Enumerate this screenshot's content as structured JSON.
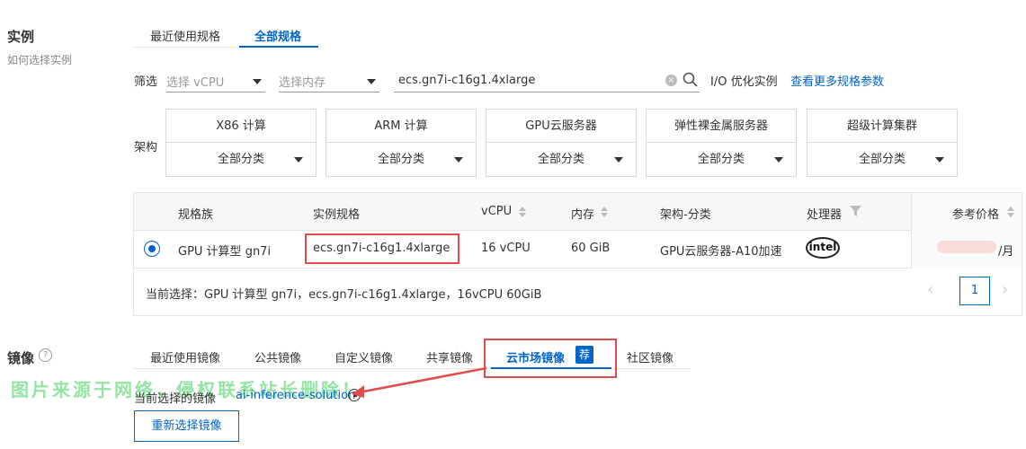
{
  "instance": {
    "section_label": "实例",
    "help_text": "如何选择实例",
    "tabs": [
      {
        "label": "最近使用规格",
        "active": false
      },
      {
        "label": "全部规格",
        "active": true
      }
    ],
    "filter": {
      "label": "筛选",
      "vcpu_placeholder": "选择 vCPU",
      "memory_placeholder": "选择内存",
      "search_value": "ecs.gn7i-c16g1.4xlarge",
      "io_optimized": "I/O 优化实例",
      "more_params_link": "查看更多规格参数"
    },
    "arch": {
      "label": "架构",
      "options": [
        {
          "name": "X86 计算",
          "value": "全部分类"
        },
        {
          "name": "ARM 计算",
          "value": "全部分类"
        },
        {
          "name": "GPU云服务器",
          "value": "全部分类"
        },
        {
          "name": "弹性裸金属服务器",
          "value": "全部分类"
        },
        {
          "name": "超级计算集群",
          "value": "全部分类"
        }
      ]
    },
    "table": {
      "headers": {
        "family": "规格族",
        "spec": "实例规格",
        "vcpu": "vCPU",
        "memory": "内存",
        "arch": "架构-分类",
        "processor": "处理器",
        "price": "参考价格"
      },
      "row": {
        "family": "GPU 计算型 gn7i",
        "spec": "ecs.gn7i-c16g1.4xlarge",
        "vcpu": "16 vCPU",
        "memory": "60 GiB",
        "arch": "GPU云服务器-A10加速",
        "processor_logo": "intel",
        "price_suffix": "/月",
        "selected": true
      },
      "current_selection": "当前选择：GPU 计算型 gn7i，ecs.gn7i-c16g1.4xlarge，16vCPU 60GiB",
      "page": "1"
    }
  },
  "image": {
    "section_label": "镜像",
    "help_icon": "question-circle-icon",
    "tabs": [
      {
        "label": "最近使用镜像",
        "active": false
      },
      {
        "label": "公共镜像",
        "active": false
      },
      {
        "label": "自定义镜像",
        "active": false
      },
      {
        "label": "共享镜像",
        "active": false
      },
      {
        "label": "云市场镜像",
        "active": true,
        "badge": "荐"
      },
      {
        "label": "社区镜像",
        "active": false
      }
    ],
    "current_label": "当前选择的镜像",
    "current_value": "ai-inference-solution",
    "reselect_button": "重新选择镜像"
  },
  "watermark": "图片来源于网络，侵权联系站长删除！",
  "colors": {
    "accent": "#0064c8",
    "highlight": "#e04b4b",
    "watermark": "#3ecf5a"
  }
}
